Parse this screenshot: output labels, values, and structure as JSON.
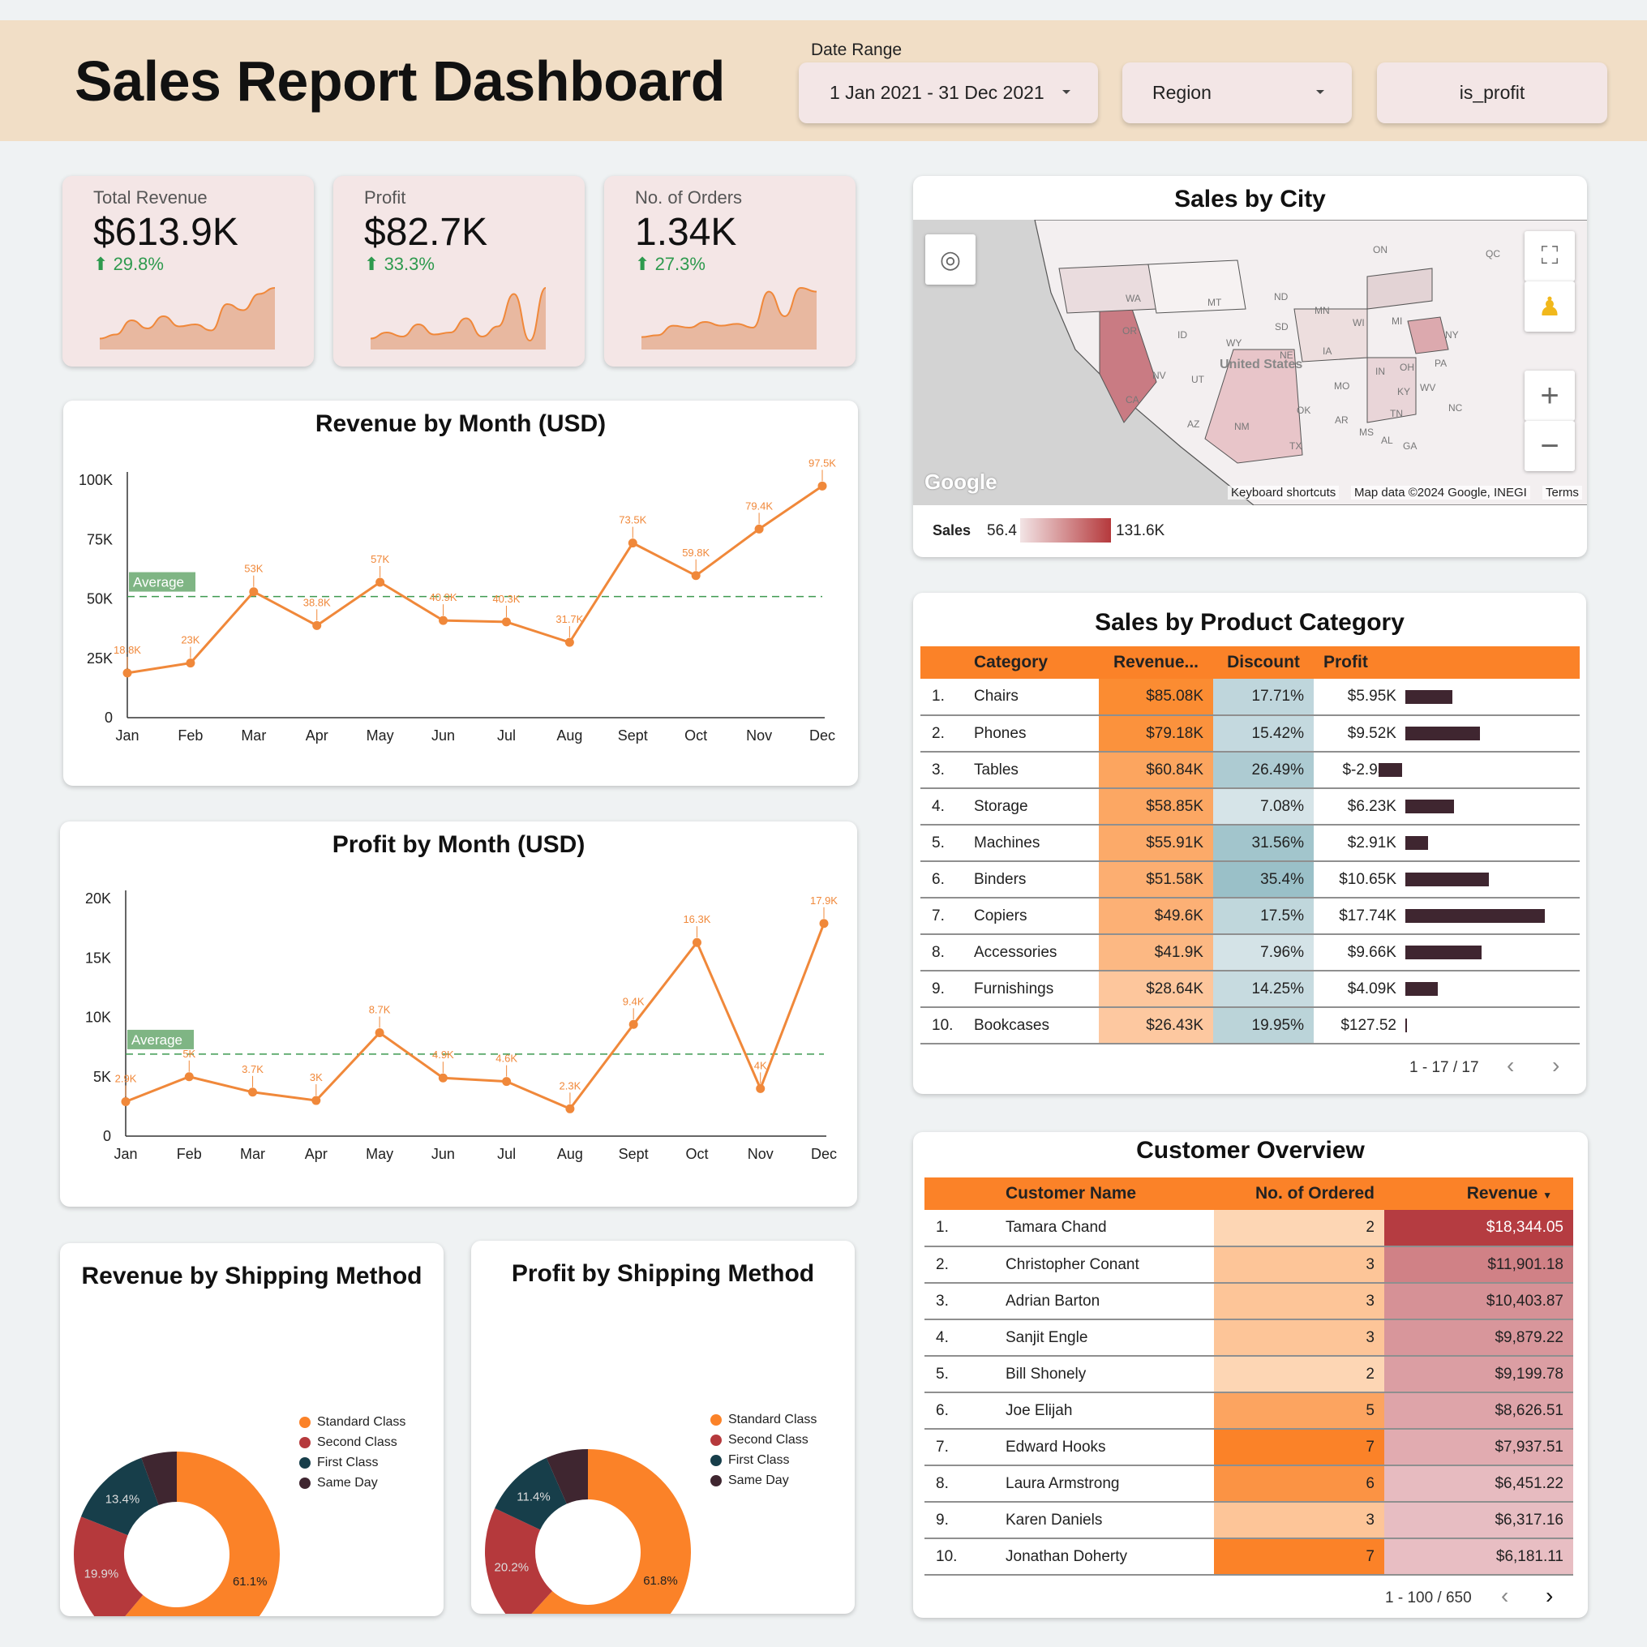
{
  "header": {
    "title": "Sales Report Dashboard",
    "date_range_label": "Date Range",
    "date_range_value": "1 Jan 2021 - 31 Dec 2021",
    "region_filter": "Region",
    "profit_filter": "is_profit"
  },
  "kpis": [
    {
      "label": "Total Revenue",
      "value": "$613.9K",
      "delta": "29.8%",
      "sparkline": [
        3,
        5,
        12,
        8,
        14,
        9,
        10,
        7,
        20,
        17,
        25,
        28
      ]
    },
    {
      "label": "Profit",
      "value": "$82.7K",
      "delta": "33.3%",
      "sparkline": [
        3,
        6,
        4,
        10,
        5,
        6,
        13,
        4,
        9,
        25,
        2,
        28
      ]
    },
    {
      "label": "No. of Orders",
      "value": "1.34K",
      "delta": "27.3%",
      "sparkline": [
        4,
        5,
        10,
        9,
        12,
        10,
        11,
        9,
        28,
        15,
        30,
        28
      ]
    }
  ],
  "revenue_chart": {
    "title": "Revenue by Month (USD)",
    "average_label": "Average",
    "y_ticks": [
      "0",
      "25K",
      "50K",
      "75K",
      "100K"
    ],
    "data_labels": [
      "18.8K",
      "23K",
      "53K",
      "38.8K",
      "57K",
      "40.9K",
      "40.3K",
      "31.7K",
      "73.5K",
      "59.8K",
      "79.4K",
      "97.5K"
    ]
  },
  "profit_chart": {
    "title": "Profit by Month (USD)",
    "average_label": "Average",
    "y_ticks": [
      "0",
      "5K",
      "10K",
      "15K",
      "20K"
    ],
    "data_labels": [
      "2.9K",
      "5K",
      "3.7K",
      "3K",
      "8.7K",
      "4.9K",
      "4.6K",
      "2.3K",
      "9.4K",
      "16.3K",
      "4K",
      "17.9K"
    ]
  },
  "chart_data": [
    {
      "type": "line",
      "title": "Revenue by Month (USD)",
      "x": [
        "Jan",
        "Feb",
        "Mar",
        "Apr",
        "May",
        "Jun",
        "Jul",
        "Aug",
        "Sept",
        "Oct",
        "Nov",
        "Dec"
      ],
      "values": [
        18.8,
        23,
        53,
        38.8,
        57,
        40.9,
        40.3,
        31.7,
        73.5,
        59.8,
        79.4,
        97.5
      ],
      "average": 51,
      "ylim": [
        0,
        100
      ]
    },
    {
      "type": "line",
      "title": "Profit by Month (USD)",
      "x": [
        "Jan",
        "Feb",
        "Mar",
        "Apr",
        "May",
        "Jun",
        "Jul",
        "Aug",
        "Sept",
        "Oct",
        "Nov",
        "Dec"
      ],
      "values": [
        2.9,
        5,
        3.7,
        3,
        8.7,
        4.9,
        4.6,
        2.3,
        9.4,
        16.3,
        4,
        17.9
      ],
      "average": 6.9,
      "ylim": [
        0,
        20
      ]
    },
    {
      "type": "pie",
      "title": "Revenue by Shipping Method",
      "categories": [
        "Standard Class",
        "Second Class",
        "First Class",
        "Same Day"
      ],
      "values": [
        61.1,
        19.9,
        13.4,
        5.6
      ],
      "labels": [
        "61.1%",
        "19.9%",
        "13.4%",
        ""
      ]
    },
    {
      "type": "pie",
      "title": "Profit by Shipping Method",
      "categories": [
        "Standard Class",
        "Second Class",
        "First Class",
        "Same Day"
      ],
      "values": [
        61.8,
        20.2,
        11.4,
        6.6
      ],
      "labels": [
        "61.8%",
        "20.2%",
        "11.4%",
        ""
      ]
    }
  ],
  "colors": {
    "orange": "#fb8228",
    "red": "#b5393c",
    "teal": "#173e4a",
    "dark": "#3f2630",
    "avg_green": "#3f9a50"
  },
  "map": {
    "title": "Sales by City",
    "legend_label": "Sales",
    "legend_min": "56.4",
    "legend_max": "131.6K",
    "attribution_keys": "Keyboard shortcuts",
    "attribution_data": "Map data ©2024 Google, INEGI",
    "attribution_terms": "Terms",
    "logo": "Google",
    "states": [
      "WA",
      "MT",
      "ND",
      "OR",
      "ID",
      "WY",
      "SD",
      "NE",
      "NV",
      "UT",
      "CA",
      "AZ",
      "NM",
      "TX",
      "OK",
      "MN",
      "IA",
      "MO",
      "AR",
      "WI",
      "MI",
      "IN",
      "OH",
      "PA",
      "NY",
      "KY",
      "TN",
      "MS",
      "AL",
      "GA",
      "NC",
      "WV",
      "ON",
      "QC"
    ],
    "country_label": "United States"
  },
  "category_table": {
    "title": "Sales by Product Category",
    "columns": [
      "Category",
      "Revenue...",
      "Discount",
      "Profit"
    ],
    "rows": [
      {
        "idx": "1.",
        "category": "Chairs",
        "revenue": "$85.08K",
        "discount": "17.71%",
        "profit": "$5.95K",
        "profit_val": 5.95
      },
      {
        "idx": "2.",
        "category": "Phones",
        "revenue": "$79.18K",
        "discount": "15.42%",
        "profit": "$9.52K",
        "profit_val": 9.52
      },
      {
        "idx": "3.",
        "category": "Tables",
        "revenue": "$60.84K",
        "discount": "26.49%",
        "profit": "$-2.95K",
        "profit_val": -2.95
      },
      {
        "idx": "4.",
        "category": "Storage",
        "revenue": "$58.85K",
        "discount": "7.08%",
        "profit": "$6.23K",
        "profit_val": 6.23
      },
      {
        "idx": "5.",
        "category": "Machines",
        "revenue": "$55.91K",
        "discount": "31.56%",
        "profit": "$2.91K",
        "profit_val": 2.91
      },
      {
        "idx": "6.",
        "category": "Binders",
        "revenue": "$51.58K",
        "discount": "35.4%",
        "profit": "$10.65K",
        "profit_val": 10.65
      },
      {
        "idx": "7.",
        "category": "Copiers",
        "revenue": "$49.6K",
        "discount": "17.5%",
        "profit": "$17.74K",
        "profit_val": 17.74
      },
      {
        "idx": "8.",
        "category": "Accessories",
        "revenue": "$41.9K",
        "discount": "7.96%",
        "profit": "$9.66K",
        "profit_val": 9.66
      },
      {
        "idx": "9.",
        "category": "Furnishings",
        "revenue": "$28.64K",
        "discount": "14.25%",
        "profit": "$4.09K",
        "profit_val": 4.09
      },
      {
        "idx": "10.",
        "category": "Bookcases",
        "revenue": "$26.43K",
        "discount": "19.95%",
        "profit": "$127.52",
        "profit_val": 0.13
      }
    ],
    "pagination": "1 - 17 / 17"
  },
  "customer_table": {
    "title": "Customer Overview",
    "columns": [
      "Customer Name",
      "No. of Ordered",
      "Revenue"
    ],
    "rows": [
      {
        "idx": "1.",
        "name": "Tamara Chand",
        "orders": "2",
        "revenue": "$18,344.05"
      },
      {
        "idx": "2.",
        "name": "Christopher Conant",
        "orders": "3",
        "revenue": "$11,901.18"
      },
      {
        "idx": "3.",
        "name": "Adrian Barton",
        "orders": "3",
        "revenue": "$10,403.87"
      },
      {
        "idx": "4.",
        "name": "Sanjit Engle",
        "orders": "3",
        "revenue": "$9,879.22"
      },
      {
        "idx": "5.",
        "name": "Bill Shonely",
        "orders": "2",
        "revenue": "$9,199.78"
      },
      {
        "idx": "6.",
        "name": "Joe Elijah",
        "orders": "5",
        "revenue": "$8,626.51"
      },
      {
        "idx": "7.",
        "name": "Edward Hooks",
        "orders": "7",
        "revenue": "$7,937.51"
      },
      {
        "idx": "8.",
        "name": "Laura Armstrong",
        "orders": "6",
        "revenue": "$6,451.22"
      },
      {
        "idx": "9.",
        "name": "Karen Daniels",
        "orders": "3",
        "revenue": "$6,317.16"
      },
      {
        "idx": "10.",
        "name": "Jonathan Doherty",
        "orders": "7",
        "revenue": "$6,181.11"
      }
    ],
    "pagination": "1 - 100 / 650"
  }
}
